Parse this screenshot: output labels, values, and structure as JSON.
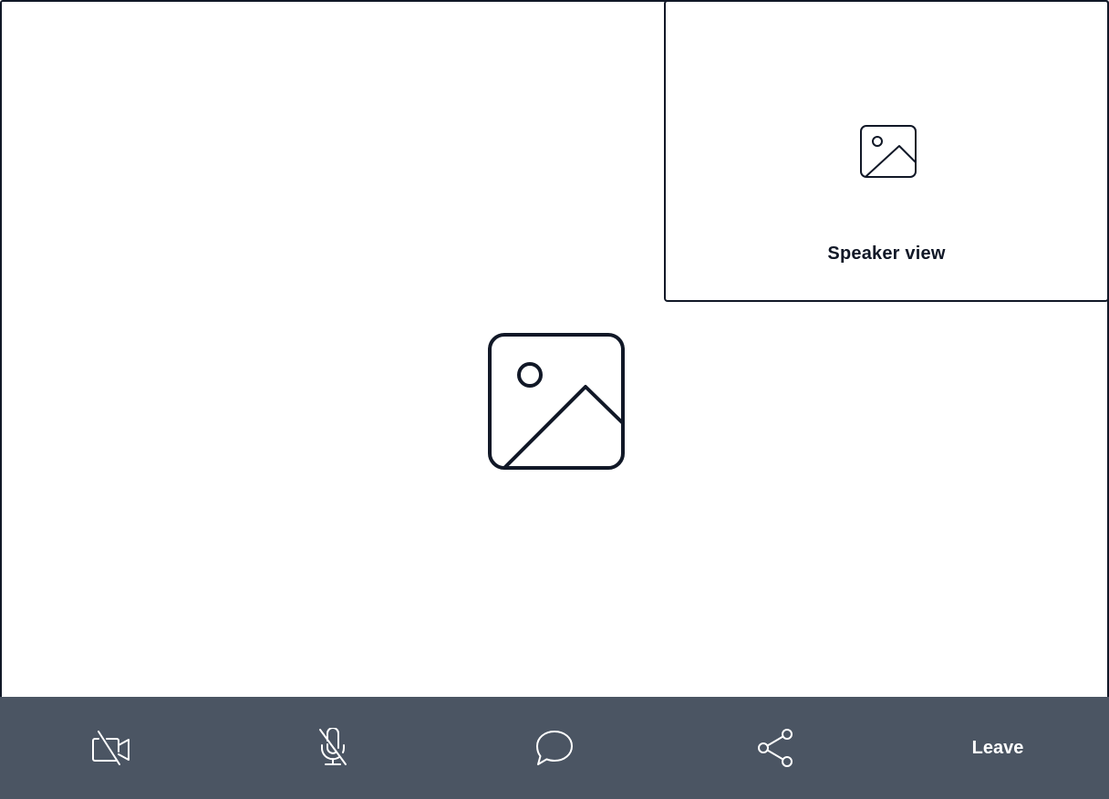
{
  "main_stage": {
    "placeholder_icon": "image-icon"
  },
  "speaker_tile": {
    "placeholder_icon": "image-icon",
    "label": "Speaker view"
  },
  "toolbar": {
    "background_color": "#4b5563",
    "camera": {
      "icon": "video-off-icon",
      "state": "off"
    },
    "microphone": {
      "icon": "mic-off-icon",
      "state": "muted"
    },
    "chat": {
      "icon": "chat-bubble-icon"
    },
    "share": {
      "icon": "share-icon"
    },
    "leave_label": "Leave"
  }
}
